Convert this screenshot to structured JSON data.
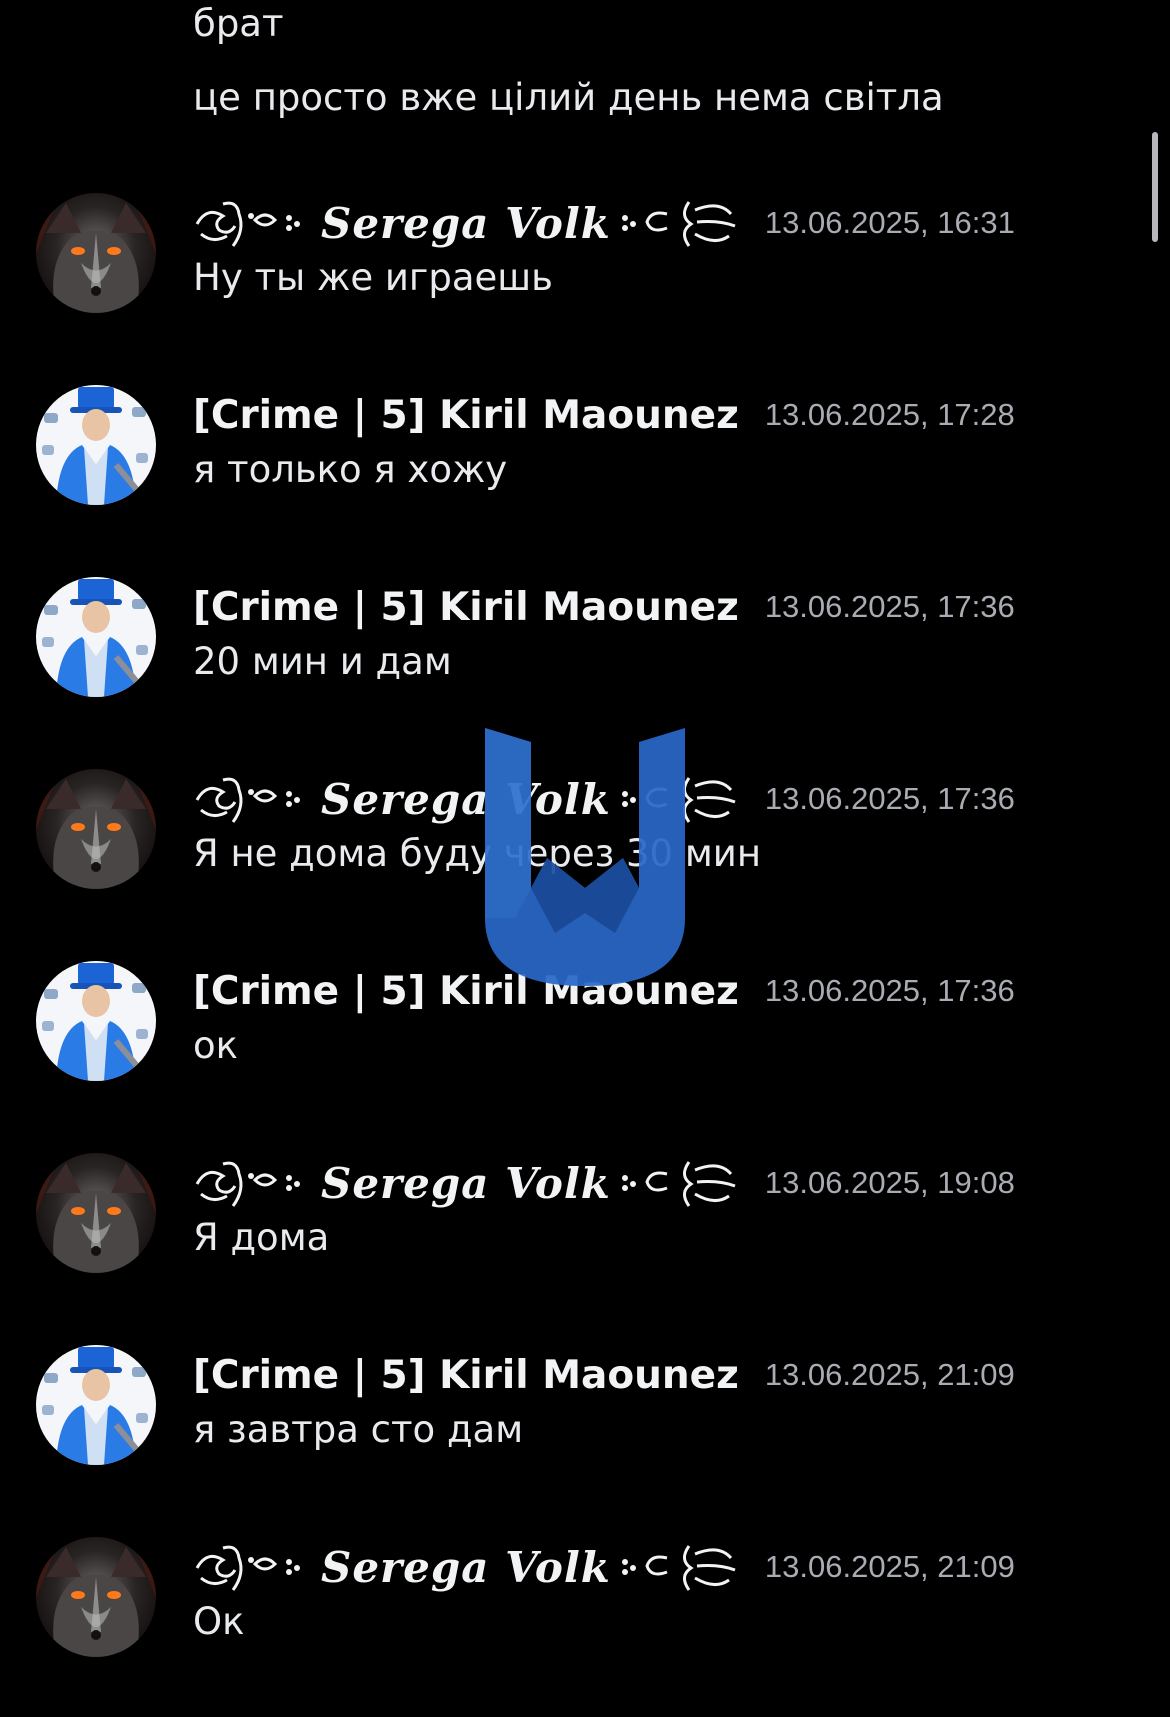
{
  "colors": {
    "background": "#000000",
    "text": "#e9eaed",
    "timestamp": "#a9acb3",
    "watermark_blue": "#2a68c8"
  },
  "previous_lines": [
    "брат",
    "це просто вже цілий день нема світла"
  ],
  "messages": [
    {
      "author": "Serega Volk",
      "avatar": "wolf-avatar",
      "timestamp": "13.06.2025, 16:31",
      "text": "Ну ты же играешь"
    },
    {
      "author": "[Crime | 5] Kiril Maounez",
      "avatar": "blue-suit-man-avatar",
      "timestamp": "13.06.2025, 17:28",
      "text": "я только я хожу"
    },
    {
      "author": "[Crime | 5] Kiril Maounez",
      "avatar": "blue-suit-man-avatar",
      "timestamp": "13.06.2025, 17:36",
      "text": "20 мин и дам"
    },
    {
      "author": "Serega Volk",
      "avatar": "wolf-avatar",
      "timestamp": "13.06.2025, 17:36",
      "text": "Я не дома буду через 30 мин"
    },
    {
      "author": "[Crime | 5] Kiril Maounez",
      "avatar": "blue-suit-man-avatar",
      "timestamp": "13.06.2025, 17:36",
      "text": "ок"
    },
    {
      "author": "Serega Volk",
      "avatar": "wolf-avatar",
      "timestamp": "13.06.2025, 19:08",
      "text": "Я дома"
    },
    {
      "author": "[Crime | 5] Kiril Maounez",
      "avatar": "blue-suit-man-avatar",
      "timestamp": "13.06.2025, 21:09",
      "text": "я завтра сто дам"
    },
    {
      "author": "Serega Volk",
      "avatar": "wolf-avatar",
      "timestamp": "13.06.2025, 21:09",
      "text": "Ок"
    }
  ],
  "watermark": {
    "icon": "blue-u-star-logo-icon"
  }
}
